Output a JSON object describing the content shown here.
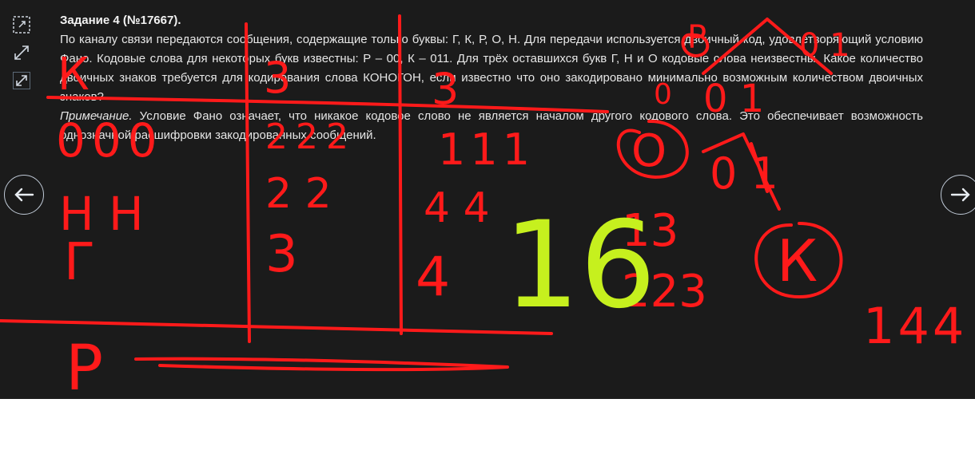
{
  "task": {
    "title": "Задание 4 (№17667).",
    "paragraph": "По каналу связи передаются сообщения, содержащие только буквы: Г, К, Р, О, Н. Для передачи используется двоичный код, удовлетворяющий условию Фано. Кодовые слова для некоторых букв известны: Р – 00, К – 011. Для трёх оставшихся букв Г, Н и О кодовые слова неизвестны. Какое количество двоичных знаков требуется для кодирования слова КОНОГОН, если известно что оно закодировано минимально возможным количеством двоичных знаков?",
    "note_label": "Примечание.",
    "note_text": " Условие Фано означает, что никакое кодовое слово не является началом другого кодового слова. Это обеспечивает возможность однозначной расшифровки закодированных сообщений."
  },
  "toolbar": {
    "icons": [
      "select-icon",
      "expand-icon",
      "collapse-icon"
    ]
  },
  "navigation": {
    "prev_icon": "arrow-left-icon",
    "next_icon": "arrow-right-icon"
  },
  "colors": {
    "background": "#1b1b1b",
    "ink_red": "#ff1a1a",
    "ink_green": "#c6f01e",
    "text": "#e6e6e6"
  },
  "annotations": {
    "col1_header": "К",
    "col2_header": "3",
    "col3_header": "3",
    "row_zeros": "000",
    "row_twos": "222",
    "row_ones": "111",
    "col1_row2": "Н Н",
    "col2_row2": "2 2",
    "col3_row2": "4 4",
    "col1_row3": "Г",
    "col2_row3": "3",
    "col3_row3": "4",
    "bottom_letter": "Р",
    "total_green": "16",
    "sum_top": "13",
    "sum_bottom": "223",
    "tree_top": "Р",
    "tree_top_digits": "0  1",
    "tree_zero": "0",
    "tree_node_o": "О",
    "tree_branch_digits": "0  1",
    "tree_node_p": "Р",
    "tree_branch2_digits": "0  1",
    "tree_node_k": "К",
    "right_number": "144"
  }
}
